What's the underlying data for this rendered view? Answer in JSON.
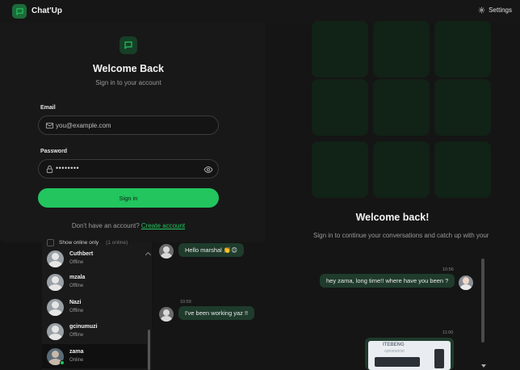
{
  "app": {
    "title": "Chat'Up",
    "settings_label": "Settings"
  },
  "login": {
    "title": "Welcome Back",
    "subtitle": "Sign in to your account",
    "email_label": "Email",
    "email_placeholder": "you@example.com",
    "password_label": "Password",
    "password_value": "••••••••",
    "signin_label": "Sign in",
    "register_prompt": "Don't have an account?",
    "register_link": "Create account"
  },
  "sidebar": {
    "online_toggle_label": "Show online only",
    "online_count": "(1 online)",
    "contacts": [
      {
        "name": "Cuthbert",
        "status": "Offline"
      },
      {
        "name": "mzala",
        "status": "Offline"
      },
      {
        "name": "Nazi",
        "status": "Offline"
      },
      {
        "name": "gcinumuzi",
        "status": "Offline"
      },
      {
        "name": "zama",
        "status": "Online"
      }
    ]
  },
  "chat": {
    "messages": [
      {
        "text": "Hello marshal 👏😊",
        "time": ""
      },
      {
        "text": "I've been working yaz !!",
        "time": "10:59"
      }
    ]
  },
  "welcome_panel": {
    "title": "Welcome back!",
    "subtitle": "Sign in to continue your conversations and catch up with your",
    "message": {
      "text": "hey zama, long time!! where have you been ?",
      "time": "10:56"
    },
    "image_time": "11:00",
    "image_caption": "ITEBENG",
    "image_subcaption": "optometrist"
  },
  "colors": {
    "accent": "#22c55e",
    "bubble": "#1f3b2c",
    "tile": "#112217"
  }
}
